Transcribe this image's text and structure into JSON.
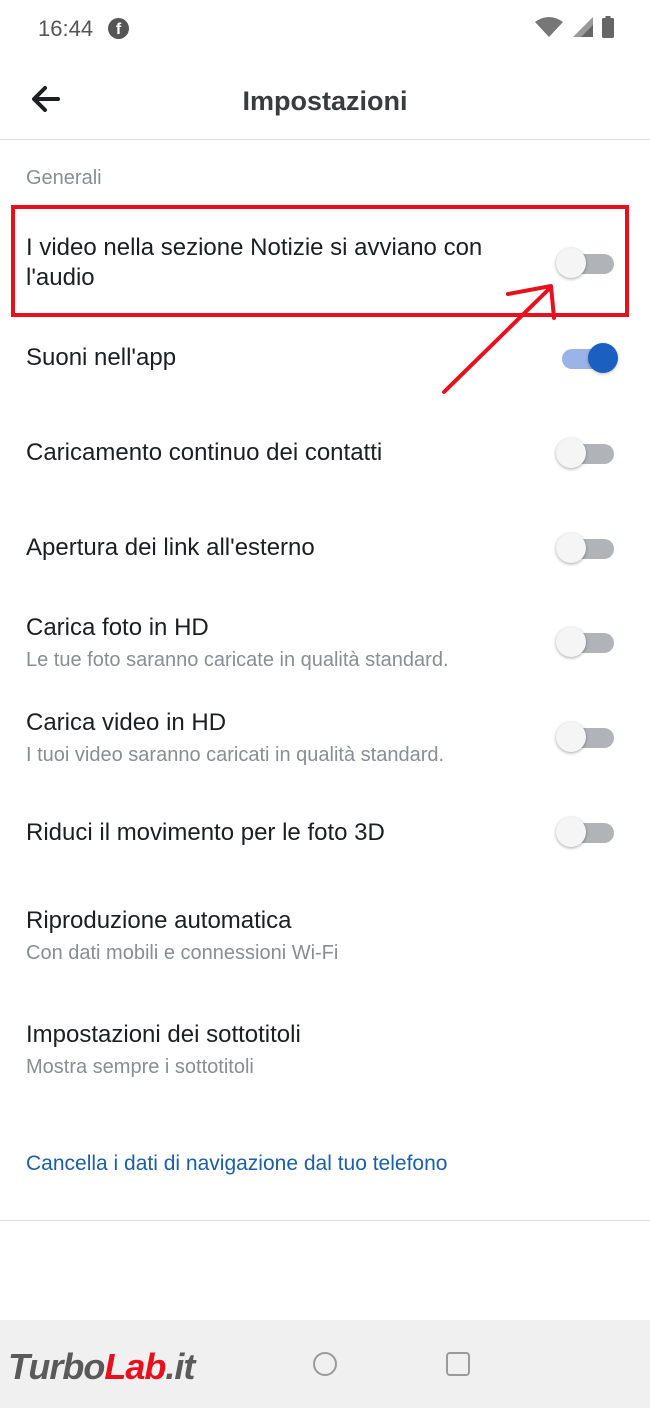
{
  "status_bar": {
    "time": "16:44",
    "notification_icon": "facebook-icon",
    "icons": [
      "wifi-icon",
      "signal-icon",
      "battery-icon"
    ]
  },
  "header": {
    "title": "Impostazioni",
    "back_icon": "arrow-left-icon"
  },
  "section": {
    "title": "Generali"
  },
  "settings": [
    {
      "title": "I video nella sezione Notizie si avviano con l'audio",
      "subtitle": "",
      "toggle": "off",
      "highlighted": true
    },
    {
      "title": "Suoni nell'app",
      "subtitle": "",
      "toggle": "on"
    },
    {
      "title": "Caricamento continuo dei contatti",
      "subtitle": "",
      "toggle": "off"
    },
    {
      "title": "Apertura dei link all'esterno",
      "subtitle": "",
      "toggle": "off"
    },
    {
      "title": "Carica foto in HD",
      "subtitle": "Le tue foto saranno caricate in qualità standard.",
      "toggle": "off"
    },
    {
      "title": "Carica video in HD",
      "subtitle": "I tuoi video saranno caricati in qualità standard.",
      "toggle": "off"
    },
    {
      "title": "Riduci il movimento per le foto 3D",
      "subtitle": "",
      "toggle": "off"
    },
    {
      "title": "Riproduzione automatica",
      "subtitle": "Con dati mobili e connessioni Wi-Fi"
    },
    {
      "title": "Impostazioni dei sottotitoli",
      "subtitle": "Mostra sempre i sottotitoli"
    }
  ],
  "clear_link": "Cancella i dati di navigazione dal tuo telefono",
  "annotation_color": "#e8101c",
  "accent_color": "#1b5fc1",
  "watermark": {
    "text_a": "Turbo",
    "text_b": "Lab",
    "text_c": ".it"
  },
  "nav_bar": {
    "buttons": [
      "home-circle-icon",
      "recents-square-icon"
    ]
  }
}
